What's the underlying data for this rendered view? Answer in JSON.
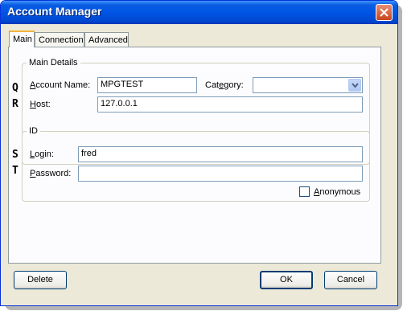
{
  "window": {
    "title": "Account Manager"
  },
  "tabs": [
    {
      "label": "Main"
    },
    {
      "label": "Connection"
    },
    {
      "label": "Advanced"
    }
  ],
  "main_details": {
    "legend": "Main Details",
    "account_name": {
      "label_prefix": "",
      "label_ul": "A",
      "label_rest": "ccount Name:",
      "value": "MPGTEST"
    },
    "category": {
      "label_prefix": "Cat",
      "label_ul": "e",
      "label_rest": "gory:",
      "value": ""
    },
    "host": {
      "label_prefix": "",
      "label_ul": "H",
      "label_rest": "ost:",
      "value": "127.0.0.1"
    }
  },
  "id_group": {
    "legend": "ID",
    "login": {
      "label_prefix": "",
      "label_ul": "L",
      "label_rest": "ogin:",
      "value": "fred"
    },
    "password": {
      "label_prefix": "",
      "label_ul": "P",
      "label_rest": "assword:",
      "value": ""
    },
    "anonymous": {
      "label_prefix": "",
      "label_ul": "A",
      "label_rest": "nonymous",
      "checked": false
    }
  },
  "side_letters": [
    "Q",
    "R",
    "S",
    "T"
  ],
  "buttons": {
    "delete": "Delete",
    "ok": "OK",
    "cancel": "Cancel"
  },
  "icons": {
    "close": "close-icon",
    "dropdown": "chevron-down-icon"
  }
}
